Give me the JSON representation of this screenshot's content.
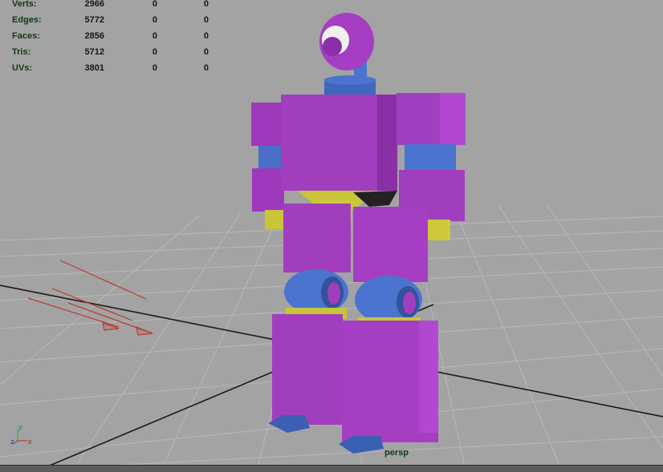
{
  "hud": {
    "rows": [
      {
        "label": "Verts:",
        "v1": "2966",
        "v2": "0",
        "v3": "0"
      },
      {
        "label": "Edges:",
        "v1": "5772",
        "v2": "0",
        "v3": "0"
      },
      {
        "label": "Faces:",
        "v1": "2856",
        "v2": "0",
        "v3": "0"
      },
      {
        "label": "Tris:",
        "v1": "5712",
        "v2": "0",
        "v3": "0"
      },
      {
        "label": "UVs:",
        "v1": "3801",
        "v2": "0",
        "v3": "0"
      }
    ]
  },
  "camera_label": "persp",
  "axis": {
    "y": "y",
    "z": "z",
    "x": "x"
  },
  "colors": {
    "background": "#a3a3a3",
    "grid": "#b7b7b7",
    "axis_lines": "#111111",
    "purple": "#a63fc1",
    "blue": "#4a74cf",
    "yellow": "#c9c43a",
    "light_arrows": "#c0392b"
  }
}
